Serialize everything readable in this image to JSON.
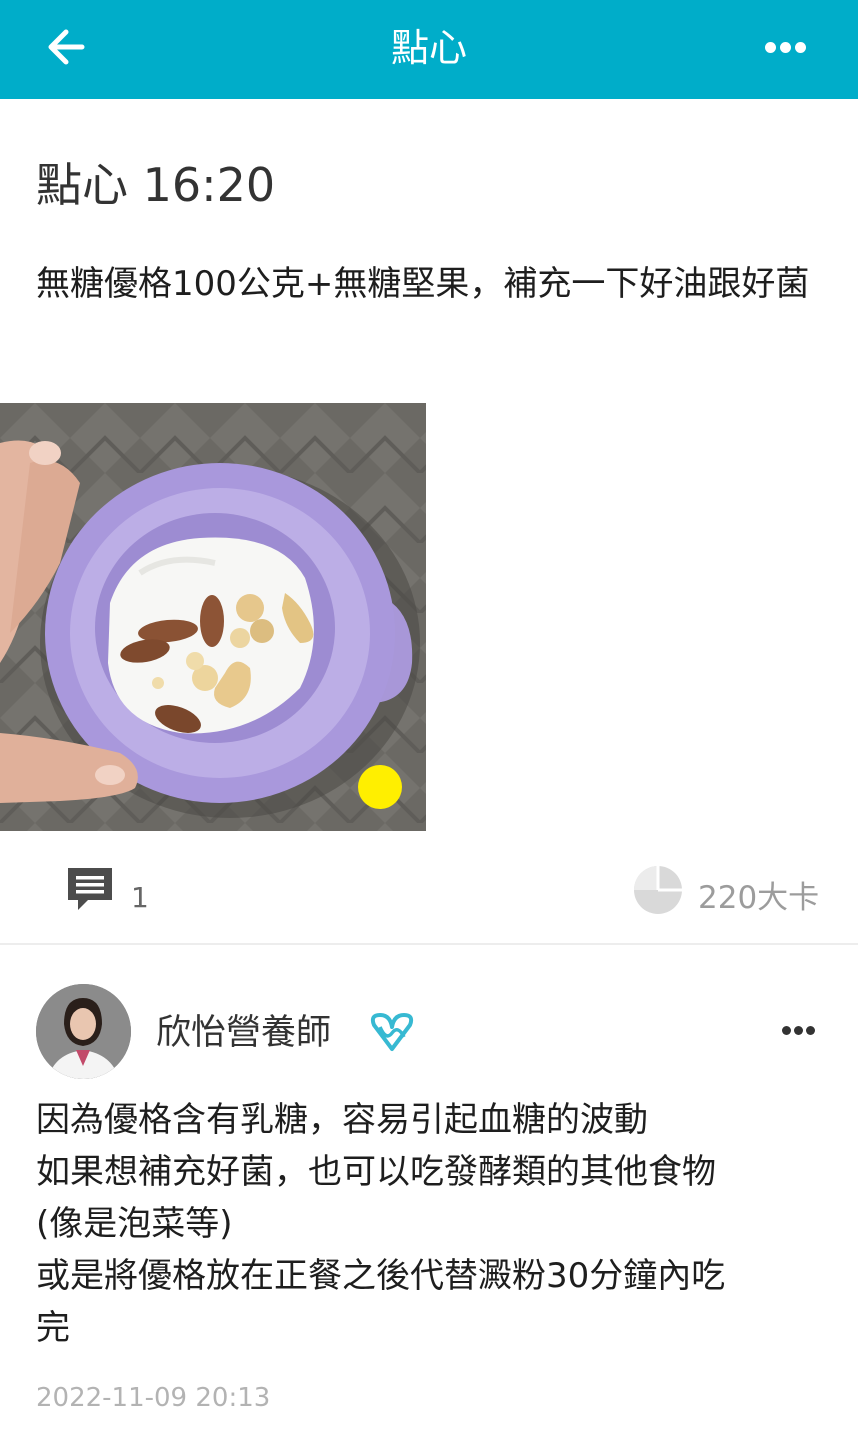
{
  "header": {
    "title": "點心",
    "back_icon": "arrow-left-icon",
    "more_icon": "more-horizontal-icon",
    "background_color": "#00adc9"
  },
  "post": {
    "title": "點心 16:20",
    "description": "無糖優格100公克+無糖堅果，補充一下好油跟好菌",
    "photo_icon": "food-photo-yogurt-nuts",
    "stats": {
      "comment_icon": "comment-icon",
      "comment_count": "1",
      "calorie_icon": "calorie-pie-icon",
      "calories": "220大卡"
    }
  },
  "comment": {
    "author_name": "欣怡營養師",
    "verified_icon": "dietitian-badge-icon",
    "more_icon": "more-horizontal-icon",
    "lines": [
      "因為優格含有乳糖，容易引起血糖的波動",
      "如果想補充好菌，也可以吃發酵類的其他食物",
      "(像是泡菜等)",
      "或是將優格放在正餐之後代替澱粉30分鐘內吃",
      "完"
    ],
    "timestamp": "2022-11-09 20:13"
  }
}
